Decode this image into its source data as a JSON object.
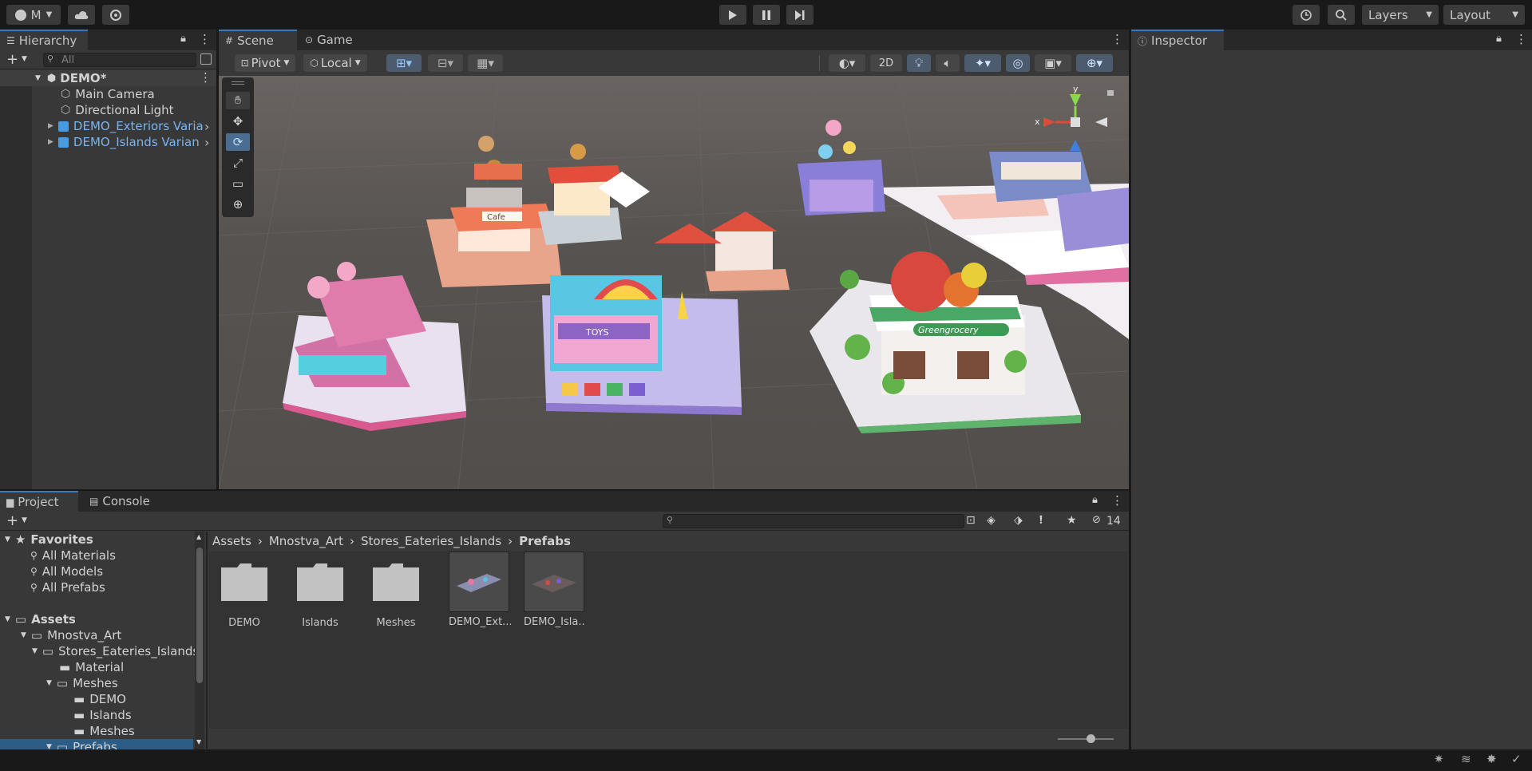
{
  "topbar": {
    "account_label": "M",
    "play_icon": "play-icon",
    "pause_icon": "pause-icon",
    "step_icon": "step-icon",
    "layers_label": "Layers",
    "layout_label": "Layout"
  },
  "hierarchy": {
    "tab_label": "Hierarchy",
    "search_placeholder": "All",
    "scene_name": "DEMO*",
    "items": [
      {
        "label": "Main Camera",
        "type": "gameobject"
      },
      {
        "label": "Directional Light",
        "type": "gameobject"
      },
      {
        "label": "DEMO_Exteriors Varia",
        "type": "prefab"
      },
      {
        "label": "DEMO_Islands Varian",
        "type": "prefab"
      }
    ]
  },
  "scene_view": {
    "tabs": [
      "Scene",
      "Game"
    ],
    "pivot_label": "Pivot",
    "local_label": "Local",
    "mode_2d_label": "2D",
    "gizmo_axes": {
      "x": "x",
      "y": "y"
    },
    "signs": {
      "cafe": "Cafe",
      "toys": "TOYS",
      "grocery": "Greengrocery"
    }
  },
  "inspector": {
    "tab_label": "Inspector"
  },
  "project": {
    "tabs": [
      "Project",
      "Console"
    ],
    "hidden_count": "14",
    "tree": {
      "favorites_label": "Favorites",
      "favorites": [
        "All Materials",
        "All Models",
        "All Prefabs"
      ],
      "assets_label": "Assets",
      "nodes": [
        {
          "label": "Mnostva_Art",
          "depth": 1
        },
        {
          "label": "Stores_Eateries_Islands",
          "depth": 2
        },
        {
          "label": "Material",
          "depth": 3
        },
        {
          "label": "Meshes",
          "depth": 3
        },
        {
          "label": "DEMO",
          "depth": 4
        },
        {
          "label": "Islands",
          "depth": 4
        },
        {
          "label": "Meshes",
          "depth": 4
        },
        {
          "label": "Prefabs",
          "depth": 3
        }
      ]
    },
    "breadcrumb": [
      "Assets",
      "Mnostva_Art",
      "Stores_Eateries_Islands",
      "Prefabs"
    ],
    "items": [
      {
        "name": "DEMO",
        "kind": "folder"
      },
      {
        "name": "Islands",
        "kind": "folder"
      },
      {
        "name": "Meshes",
        "kind": "folder"
      },
      {
        "name": "DEMO_Ext...",
        "kind": "prefab"
      },
      {
        "name": "DEMO_Isla...",
        "kind": "prefab"
      }
    ]
  },
  "colors": {
    "accent": "#3a79bb",
    "prefab_text": "#7ab4f0",
    "selection": "#2c5d87"
  }
}
